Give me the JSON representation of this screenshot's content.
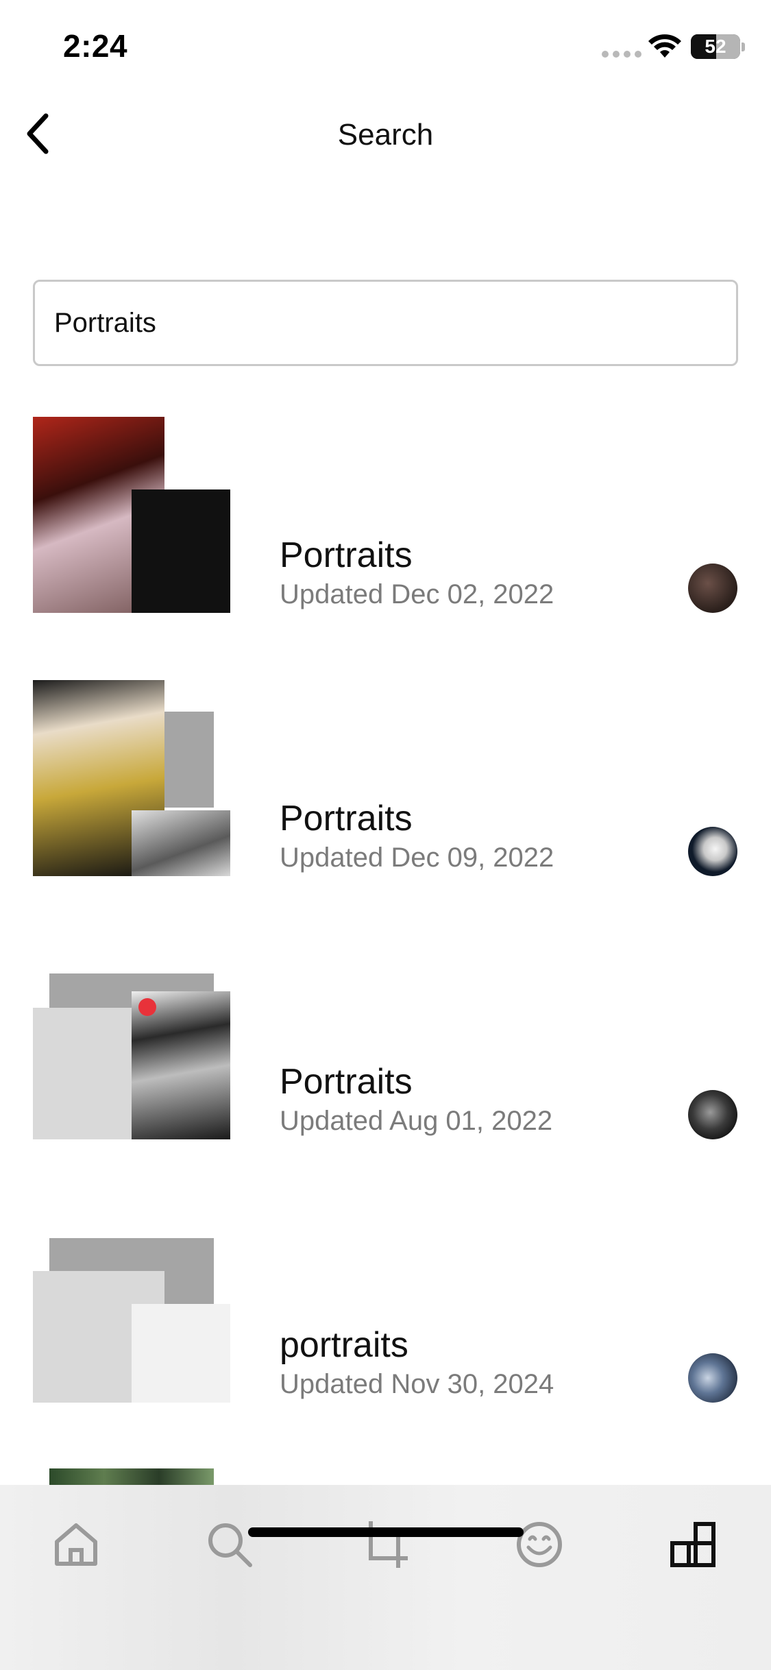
{
  "status_bar": {
    "time": "2:24",
    "battery": "52",
    "battery_level": 0.52
  },
  "header": {
    "title": "Search",
    "back_icon": "chevron-left-icon"
  },
  "search": {
    "value": "Portraits"
  },
  "results": [
    {
      "title": "Portraits",
      "date": "Updated Dec 02, 2022"
    },
    {
      "title": "Portraits",
      "date": "Updated Dec 09, 2022"
    },
    {
      "title": "Portraits",
      "date": "Updated Aug 01, 2022"
    },
    {
      "title": "portraits",
      "date": "Updated Nov 30, 2024"
    }
  ],
  "tab_bar": {
    "tabs": [
      {
        "icon": "home-icon",
        "active": false
      },
      {
        "icon": "search-icon",
        "active": false
      },
      {
        "icon": "crop-icon",
        "active": false
      },
      {
        "icon": "smiley-icon",
        "active": false
      },
      {
        "icon": "library-icon",
        "active": true
      }
    ]
  },
  "colors": {
    "text": "#111111",
    "secondary": "#7b7b7b",
    "inactive_icon": "#9a9a9a",
    "border": "#c9c9c9"
  }
}
